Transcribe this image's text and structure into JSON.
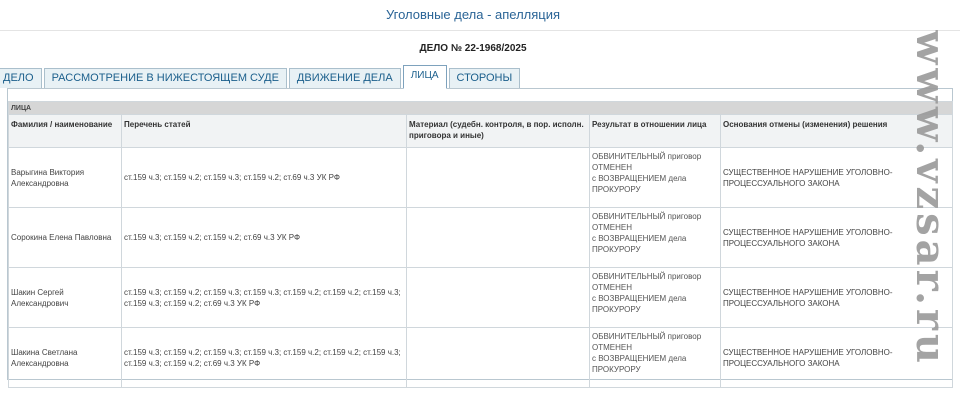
{
  "header": {
    "title": "Уголовные дела - апелляция"
  },
  "case": {
    "number": "ДЕЛО № 22-1968/2025"
  },
  "tabs": [
    {
      "label": "ДЕЛО"
    },
    {
      "label": "РАССМОТРЕНИЕ В НИЖЕСТОЯЩЕМ СУДЕ"
    },
    {
      "label": "ДВИЖЕНИЕ ДЕЛА"
    },
    {
      "label": "ЛИЦА"
    },
    {
      "label": "СТОРОНЫ"
    }
  ],
  "active_tab": "ЛИЦА",
  "section": {
    "title": "ЛИЦА"
  },
  "columns": [
    "Фамилия / наименование",
    "Перечень статей",
    "Материал (судебн. контроля, в пор. исполн. приговора и иные)",
    "Результат в отношении лица",
    "Основания отмены (изменения) решения"
  ],
  "rows": [
    {
      "name": "Варыгина Виктория Александровна",
      "articles": "ст.159 ч.3; ст.159 ч.2; ст.159 ч.3; ст.159 ч.2; ст.69 ч.3 УК РФ",
      "material": "",
      "result": [
        "ОБВИНИТЕЛЬНЫЙ приговор",
        "ОТМЕНЕН",
        "с ВОЗВРАЩЕНИЕМ дела",
        "ПРОКУРОРУ"
      ],
      "reason": "СУЩЕСТВЕННОЕ НАРУШЕНИЕ УГОЛОВНО-ПРОЦЕССУАЛЬНОГО ЗАКОНА"
    },
    {
      "name": "Сорокина Елена Павловна",
      "articles": "ст.159 ч.3; ст.159 ч.2; ст.159 ч.2; ст.69 ч.3 УК РФ",
      "material": "",
      "result": [
        "ОБВИНИТЕЛЬНЫЙ приговор",
        "ОТМЕНЕН",
        "с ВОЗВРАЩЕНИЕМ дела",
        "ПРОКУРОРУ"
      ],
      "reason": "СУЩЕСТВЕННОЕ НАРУШЕНИЕ УГОЛОВНО-ПРОЦЕССУАЛЬНОГО ЗАКОНА"
    },
    {
      "name": "Шакин Сергей Александрович",
      "articles": "ст.159 ч.3; ст.159 ч.2; ст.159 ч.3; ст.159 ч.3; ст.159 ч.2; ст.159 ч.2; ст.159 ч.3; ст.159 ч.3; ст.159 ч.2; ст.69 ч.3 УК РФ",
      "material": "",
      "result": [
        "ОБВИНИТЕЛЬНЫЙ приговор",
        "ОТМЕНЕН",
        "с ВОЗВРАЩЕНИЕМ дела",
        "ПРОКУРОРУ"
      ],
      "reason": "СУЩЕСТВЕННОЕ НАРУШЕНИЕ УГОЛОВНО-ПРОЦЕССУАЛЬНОГО ЗАКОНА"
    },
    {
      "name": "Шакина Светлана Александровна",
      "articles": "ст.159 ч.3; ст.159 ч.2; ст.159 ч.3; ст.159 ч.3; ст.159 ч.2; ст.159 ч.2; ст.159 ч.3; ст.159 ч.3; ст.159 ч.2; ст.69 ч.3 УК РФ",
      "material": "",
      "result": [
        "ОБВИНИТЕЛЬНЫЙ приговор",
        "ОТМЕНЕН",
        "с ВОЗВРАЩЕНИЕМ дела",
        "ПРОКУРОРУ"
      ],
      "reason": "СУЩЕСТВЕННОЕ НАРУШЕНИЕ УГОЛОВНО-ПРОЦЕССУАЛЬНОГО ЗАКОНА"
    }
  ],
  "watermark": {
    "text": "www.vzsar.ru"
  }
}
